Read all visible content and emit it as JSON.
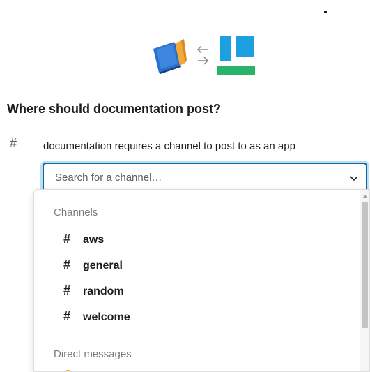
{
  "dialog": {
    "title": "Where should documentation post?",
    "requirement_text": "documentation requires a channel to post to as an app",
    "hash_glyph": "#"
  },
  "icons": {
    "source_app": "book-icon",
    "connection": "swap-arrows-icon",
    "target_app": "app-logo-icon",
    "dropdown": "chevron-down-icon"
  },
  "search": {
    "placeholder": "Search for a channel…"
  },
  "dropdown": {
    "channels_header": "Channels",
    "channels": [
      {
        "hash": "#",
        "name": "aws"
      },
      {
        "hash": "#",
        "name": "general"
      },
      {
        "hash": "#",
        "name": "random"
      },
      {
        "hash": "#",
        "name": "welcome"
      }
    ],
    "dms_header": "Direct messages"
  },
  "colors": {
    "focus_border": "#1264a3",
    "logo_blue": "#1ca0e0",
    "logo_green": "#29b36a"
  }
}
